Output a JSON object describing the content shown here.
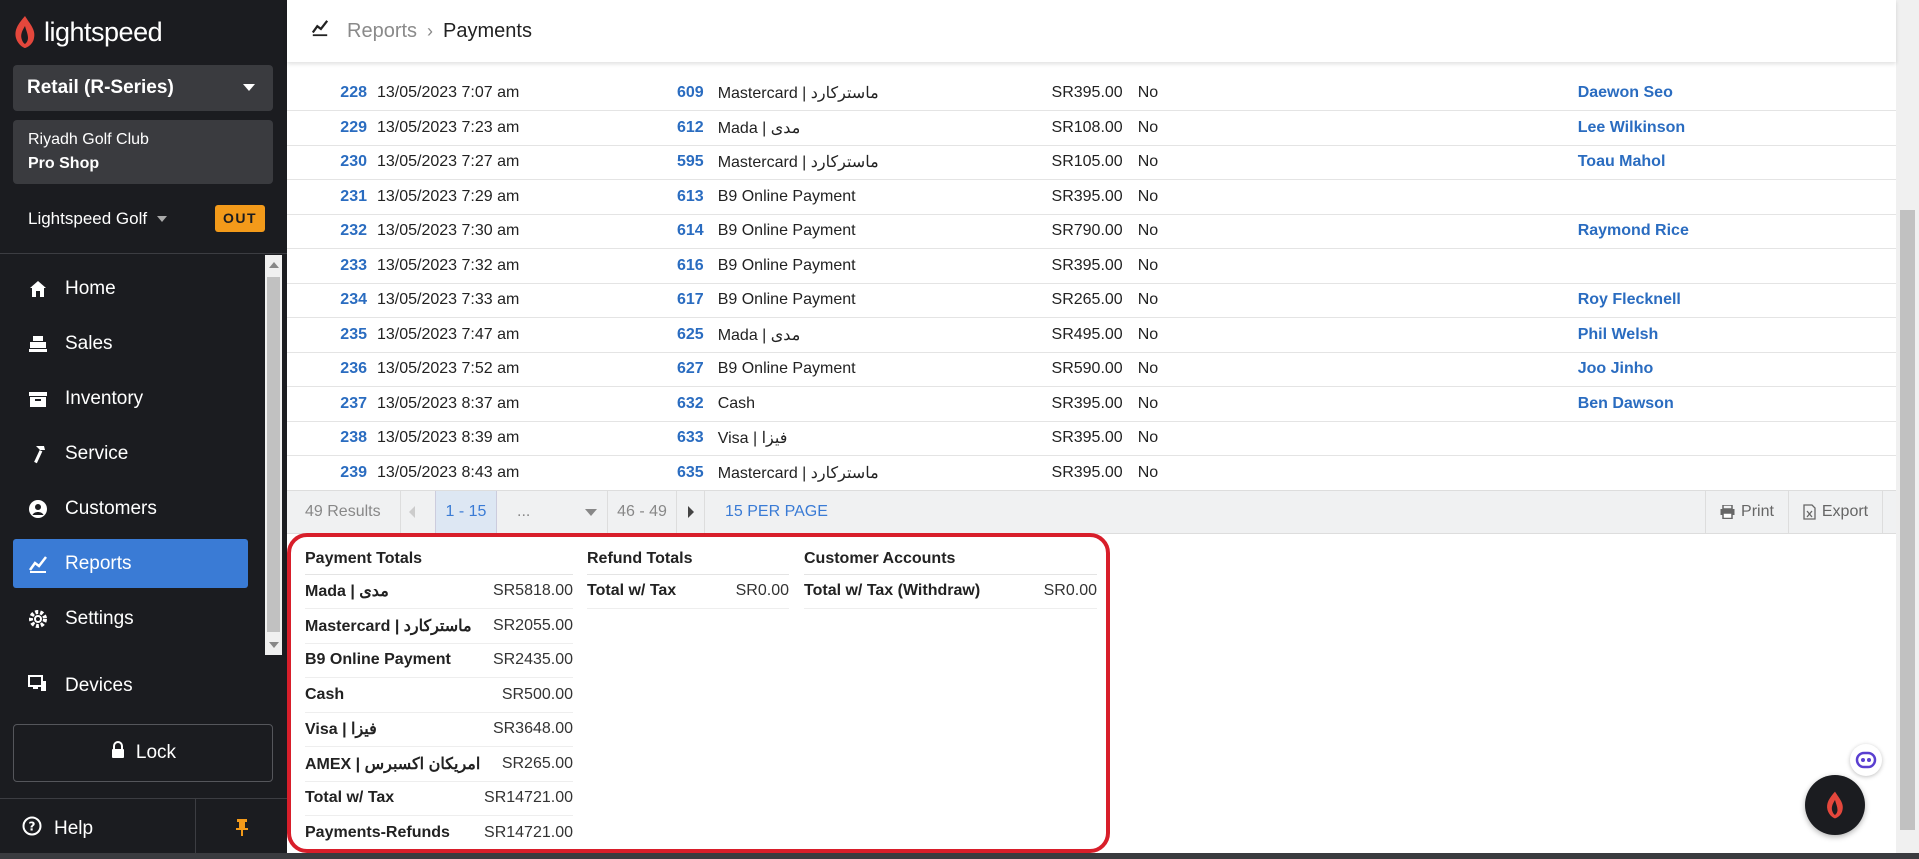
{
  "app": {
    "brand": "lightspeed",
    "accent": "#3a7bd5",
    "brand_red": "#e4473c",
    "highlight": "#d81e2a"
  },
  "sidebar": {
    "product": "Retail (R-Series)",
    "location_line1": "Riyadh Golf Club",
    "location_line2": "Pro Shop",
    "shop_name": "Lightspeed Golf",
    "status_badge": "OUT",
    "items": [
      {
        "label": "Home",
        "icon": "home-icon"
      },
      {
        "label": "Sales",
        "icon": "register-icon"
      },
      {
        "label": "Inventory",
        "icon": "inventory-icon"
      },
      {
        "label": "Service",
        "icon": "hammer-icon"
      },
      {
        "label": "Customers",
        "icon": "customer-icon"
      },
      {
        "label": "Reports",
        "icon": "chart-icon",
        "active": true
      },
      {
        "label": "Settings",
        "icon": "gear-icon"
      }
    ],
    "devices": "Devices",
    "lock": "Lock",
    "help": "Help"
  },
  "breadcrumb": {
    "parent": "Reports",
    "current": "Payments"
  },
  "table": {
    "rows": [
      {
        "id": "228",
        "date": "13/05/2023 7:07 am",
        "sale": "609",
        "type": "Mastercard | ماستركارد",
        "amount": "SR395.00",
        "refund": "No",
        "customer": "Daewon Seo"
      },
      {
        "id": "229",
        "date": "13/05/2023 7:23 am",
        "sale": "612",
        "type": "Mada | مدى",
        "amount": "SR108.00",
        "refund": "No",
        "customer": "Lee Wilkinson"
      },
      {
        "id": "230",
        "date": "13/05/2023 7:27 am",
        "sale": "595",
        "type": "Mastercard | ماستركارد",
        "amount": "SR105.00",
        "refund": "No",
        "customer": "Toau Mahol"
      },
      {
        "id": "231",
        "date": "13/05/2023 7:29 am",
        "sale": "613",
        "type": "B9 Online Payment",
        "amount": "SR395.00",
        "refund": "No",
        "customer": ""
      },
      {
        "id": "232",
        "date": "13/05/2023 7:30 am",
        "sale": "614",
        "type": "B9 Online Payment",
        "amount": "SR790.00",
        "refund": "No",
        "customer": "Raymond Rice"
      },
      {
        "id": "233",
        "date": "13/05/2023 7:32 am",
        "sale": "616",
        "type": "B9 Online Payment",
        "amount": "SR395.00",
        "refund": "No",
        "customer": ""
      },
      {
        "id": "234",
        "date": "13/05/2023 7:33 am",
        "sale": "617",
        "type": "B9 Online Payment",
        "amount": "SR265.00",
        "refund": "No",
        "customer": "Roy Flecknell"
      },
      {
        "id": "235",
        "date": "13/05/2023 7:47 am",
        "sale": "625",
        "type": "Mada | مدى",
        "amount": "SR495.00",
        "refund": "No",
        "customer": "Phil Welsh"
      },
      {
        "id": "236",
        "date": "13/05/2023 7:52 am",
        "sale": "627",
        "type": "B9 Online Payment",
        "amount": "SR590.00",
        "refund": "No",
        "customer": "Joo Jinho"
      },
      {
        "id": "237",
        "date": "13/05/2023 8:37 am",
        "sale": "632",
        "type": "Cash",
        "amount": "SR395.00",
        "refund": "No",
        "customer": "Ben Dawson"
      },
      {
        "id": "238",
        "date": "13/05/2023 8:39 am",
        "sale": "633",
        "type": "Visa | فيزا",
        "amount": "SR395.00",
        "refund": "No",
        "customer": ""
      },
      {
        "id": "239",
        "date": "13/05/2023 8:43 am",
        "sale": "635",
        "type": "Mastercard | ماستركارد",
        "amount": "SR395.00",
        "refund": "No",
        "customer": ""
      }
    ]
  },
  "pager": {
    "results": "49 Results",
    "current_range": "1 - 15",
    "ellipsis": "...",
    "last_range": "46 - 49",
    "per_page": "15 PER PAGE",
    "print": "Print",
    "export": "Export"
  },
  "totals": {
    "payment": {
      "title": "Payment Totals",
      "rows": [
        {
          "label": "Mada | مدى",
          "value": "SR5818.00"
        },
        {
          "label": "Mastercard | ماستركارد",
          "value": "SR2055.00"
        },
        {
          "label": "B9 Online Payment",
          "value": "SR2435.00"
        },
        {
          "label": "Cash",
          "value": "SR500.00"
        },
        {
          "label": "Visa | فيزا",
          "value": "SR3648.00"
        },
        {
          "label": "AMEX | امريكان اكسبرس",
          "value": "SR265.00"
        },
        {
          "label": "Total w/ Tax",
          "value": "SR14721.00"
        },
        {
          "label": "Payments-Refunds",
          "value": "SR14721.00"
        }
      ]
    },
    "refund": {
      "title": "Refund Totals",
      "rows": [
        {
          "label": "Total w/ Tax",
          "value": "SR0.00"
        }
      ]
    },
    "customer": {
      "title": "Customer Accounts",
      "rows": [
        {
          "label": "Total w/ Tax (Withdraw)",
          "value": "SR0.00"
        }
      ]
    }
  }
}
